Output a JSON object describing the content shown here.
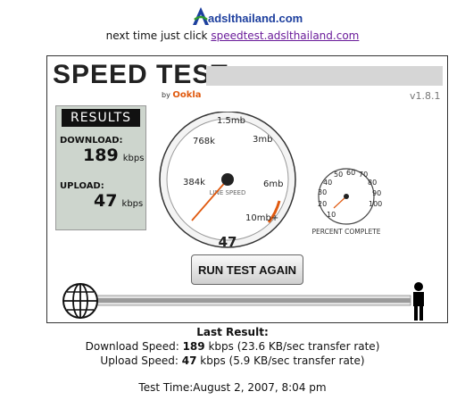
{
  "header": {
    "logo_text": "adslthailand.com",
    "tagline_prefix": "next time just click",
    "tagline_link": "speedtest.adslthailand.com"
  },
  "panel": {
    "title": "SPEED TEST",
    "by": "by",
    "brand": "Ookla",
    "version": "v1.8.1",
    "results_heading": "RESULTS",
    "download_label": "DOWNLOAD:",
    "download_value": "189",
    "download_unit": "kbps",
    "upload_label": "UPLOAD:",
    "upload_value": "47",
    "upload_unit": "kbps",
    "gauge": {
      "labels": [
        "384k",
        "768k",
        "1.5mb",
        "3mb",
        "6mb",
        "10mb+"
      ],
      "center_label": "LINE SPEED",
      "readout": "47",
      "needle_value": 47
    },
    "percent_gauge": {
      "labels": [
        "10",
        "20",
        "30",
        "40",
        "50",
        "60",
        "70",
        "80",
        "90",
        "100"
      ],
      "caption": "PERCENT COMPLETE",
      "percent": 0
    },
    "button_label": "RUN TEST AGAIN",
    "progress": 1.0,
    "colors": {
      "needle": "#e05a10",
      "accent_arc": "#e05a10"
    }
  },
  "last_result": {
    "heading": "Last Result:",
    "download_prefix": "Download Speed:",
    "download_value": "189",
    "download_suffix": "kbps (23.6 KB/sec transfer rate)",
    "upload_prefix": "Upload Speed:",
    "upload_value": "47",
    "upload_suffix": "kbps (5.9 KB/sec transfer rate)",
    "test_time": "Test Time:August 2, 2007, 8:04 pm"
  }
}
